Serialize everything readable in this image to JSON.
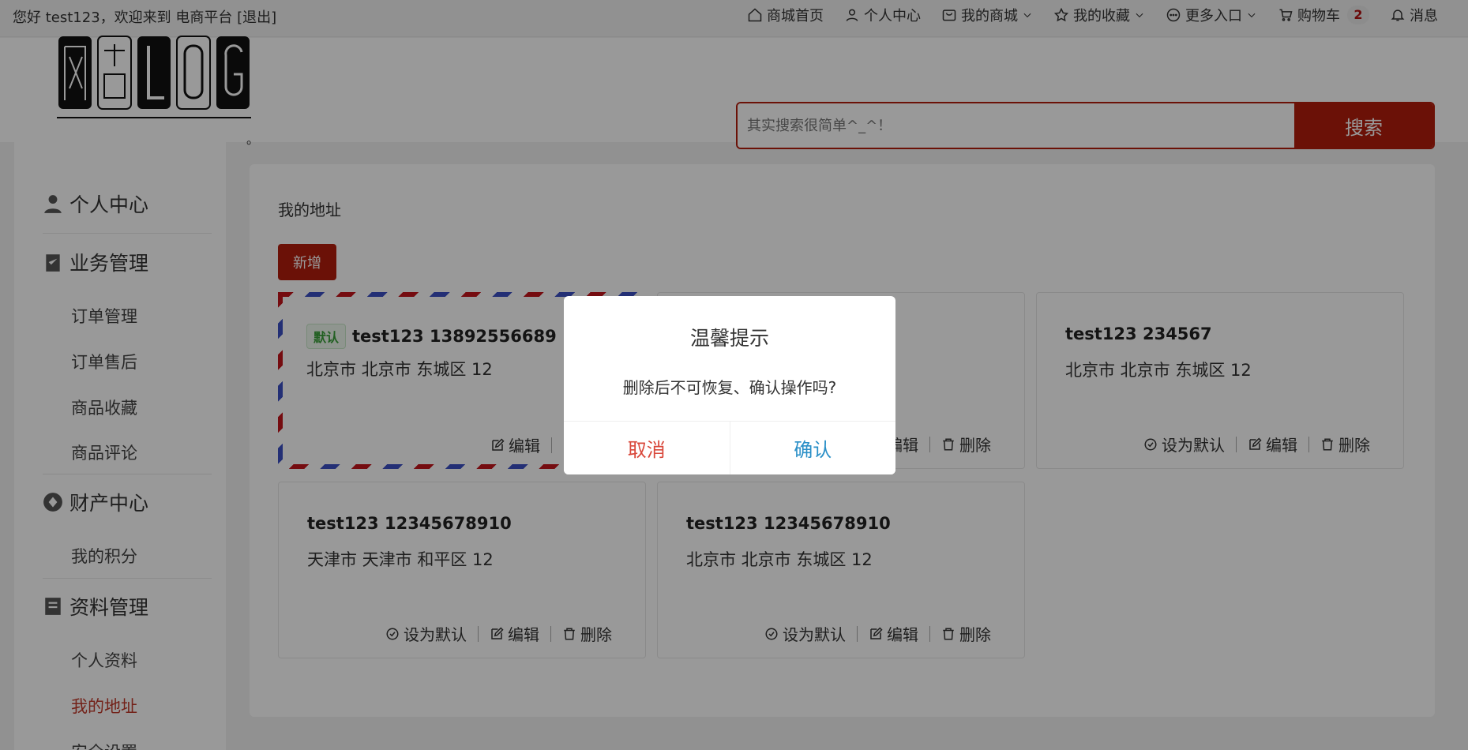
{
  "topbar": {
    "greeting": "您好 test123，欢迎来到 电商平台 [退出]",
    "nav": {
      "home": "商城首页",
      "profile": "个人中心",
      "mall": "我的商城",
      "favorites": "我的收藏",
      "more": "更多入口",
      "cart": "购物车",
      "cart_count": "2",
      "messages": "消息"
    }
  },
  "header": {
    "logo_text": "网站LOG",
    "logo_dot": "。",
    "search_placeholder": "其实搜索很简单^_^！",
    "search_button": "搜索"
  },
  "sidebar": {
    "sections": {
      "personal": "个人中心",
      "business": "业务管理",
      "assets": "财产中心",
      "profile_mgmt": "资料管理"
    },
    "items": {
      "orders": "订单管理",
      "after_sales": "订单售后",
      "fav_goods": "商品收藏",
      "reviews": "商品评论",
      "points": "我的积分",
      "personal_info": "个人资料",
      "addresses": "我的地址",
      "security": "安全设置"
    }
  },
  "main": {
    "title": "我的地址",
    "add_button": "新增",
    "default_tag": "默认",
    "actions": {
      "set_default": "设为默认",
      "edit": "编辑",
      "delete": "删除"
    },
    "cards": [
      {
        "name": "test123 13892556689",
        "address": "北京市 北京市 东城区 12"
      },
      {
        "name": "",
        "address": ""
      },
      {
        "name": "test123 234567",
        "address": "北京市 北京市 东城区 12"
      },
      {
        "name": "test123 12345678910",
        "address": "天津市 天津市 和平区 12"
      },
      {
        "name": "test123 12345678910",
        "address": "北京市 北京市 东城区 12"
      }
    ]
  },
  "dialog": {
    "title": "温馨提示",
    "message": "删除后不可恢复、确认操作吗?",
    "cancel": "取消",
    "confirm": "确认"
  },
  "colors": {
    "brand_red": "#b31d0c",
    "active_link": "#c0392b",
    "confirm_blue": "#2a8fc7",
    "cancel_red": "#d9483b"
  }
}
